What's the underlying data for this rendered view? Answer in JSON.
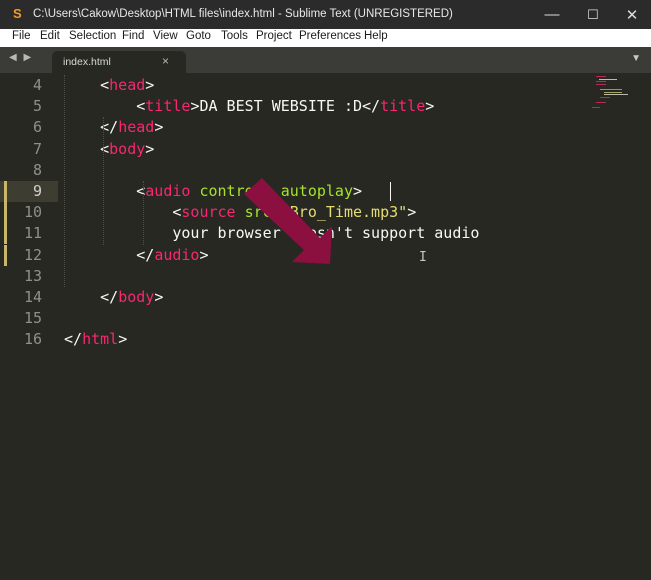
{
  "window": {
    "title": "C:\\Users\\Cakow\\Desktop\\HTML files\\index.html - Sublime Text (UNREGISTERED)",
    "app_icon_glyph": "S",
    "minimize_glyph": "—",
    "maximize_glyph": "☐",
    "close_glyph": "✕"
  },
  "menu": [
    "File",
    "Edit",
    "Selection",
    "Find",
    "View",
    "Goto",
    "Tools",
    "Project",
    "Preferences",
    "Help"
  ],
  "tabs": {
    "nav_arrows": "◀ ▶",
    "active_tab": "index.html",
    "close_glyph": "×",
    "dropdown_glyph": "▼"
  },
  "editor": {
    "line_numbers": [
      "4",
      "5",
      "6",
      "7",
      "8",
      "9",
      "10",
      "11",
      "12",
      "13",
      "14",
      "15",
      "16"
    ],
    "active_line": "9",
    "modified_lines": [
      "9",
      "10",
      "11",
      "12"
    ],
    "lines": [
      [
        {
          "t": "    ",
          "c": "p"
        },
        {
          "t": "<",
          "c": "p"
        },
        {
          "t": "head",
          "c": "t"
        },
        {
          "t": ">",
          "c": "p"
        }
      ],
      [
        {
          "t": "        ",
          "c": "p"
        },
        {
          "t": "<",
          "c": "p"
        },
        {
          "t": "title",
          "c": "t"
        },
        {
          "t": ">DA BEST WEBSITE :D</",
          "c": "p"
        },
        {
          "t": "title",
          "c": "t"
        },
        {
          "t": ">",
          "c": "p"
        }
      ],
      [
        {
          "t": "    ",
          "c": "p"
        },
        {
          "t": "</",
          "c": "p"
        },
        {
          "t": "head",
          "c": "t"
        },
        {
          "t": ">",
          "c": "p"
        }
      ],
      [
        {
          "t": "    ",
          "c": "p"
        },
        {
          "t": "<",
          "c": "p"
        },
        {
          "t": "body",
          "c": "t"
        },
        {
          "t": ">",
          "c": "p"
        }
      ],
      [],
      [
        {
          "t": "        ",
          "c": "p"
        },
        {
          "t": "<",
          "c": "p"
        },
        {
          "t": "audio",
          "c": "t"
        },
        {
          "t": " controls autoplay",
          "c": "a"
        },
        {
          "t": ">",
          "c": "p"
        }
      ],
      [
        {
          "t": "            ",
          "c": "p"
        },
        {
          "t": "<",
          "c": "p"
        },
        {
          "t": "source",
          "c": "t"
        },
        {
          "t": " src",
          "c": "a"
        },
        {
          "t": "=",
          "c": "p"
        },
        {
          "t": "\"Bro_Time.mp3\"",
          "c": "s"
        },
        {
          "t": ">",
          "c": "p"
        }
      ],
      [
        {
          "t": "            your browser doesn't support audio",
          "c": "p"
        }
      ],
      [
        {
          "t": "        ",
          "c": "p"
        },
        {
          "t": "</",
          "c": "p"
        },
        {
          "t": "audio",
          "c": "t"
        },
        {
          "t": ">",
          "c": "p"
        }
      ],
      [],
      [
        {
          "t": "    ",
          "c": "p"
        },
        {
          "t": "</",
          "c": "p"
        },
        {
          "t": "body",
          "c": "t"
        },
        {
          "t": ">",
          "c": "p"
        }
      ],
      [],
      [
        {
          "t": "</",
          "c": "p"
        },
        {
          "t": "html",
          "c": "t"
        },
        {
          "t": ">",
          "c": "p"
        }
      ]
    ]
  },
  "annotation": {
    "icon": "pointer-arrow-icon",
    "color": "#8b0f3f"
  },
  "colors": {
    "tag": "#f92672",
    "attr": "#a6e22e",
    "string": "#e6db74",
    "text": "#f8f8f2",
    "background": "#272822"
  }
}
